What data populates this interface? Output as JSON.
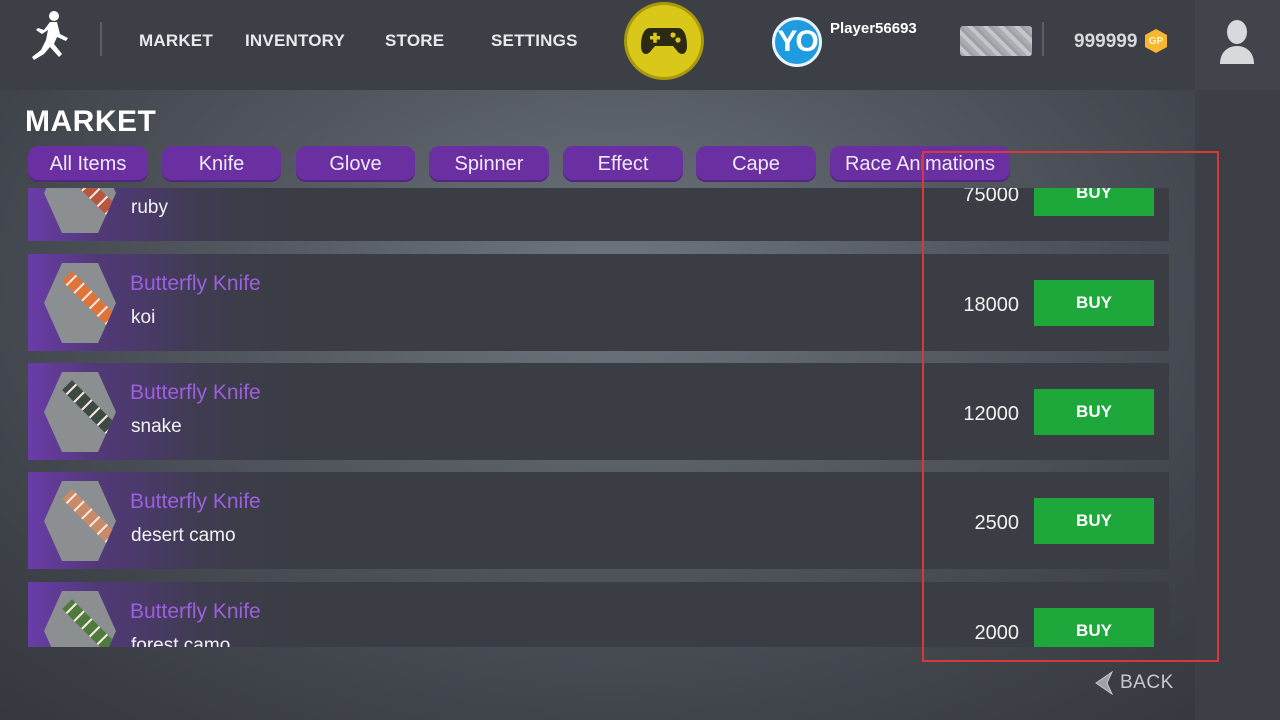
{
  "nav": {
    "items": [
      {
        "label": "MARKET"
      },
      {
        "label": "INVENTORY"
      },
      {
        "label": "STORE"
      },
      {
        "label": "SETTINGS"
      }
    ]
  },
  "player": {
    "logo_text": "YO",
    "name": "Player56693",
    "coins": "999999",
    "coin_symbol": "GP"
  },
  "market": {
    "title": "MARKET",
    "tabs": [
      {
        "label": "All Items"
      },
      {
        "label": "Knife"
      },
      {
        "label": "Glove"
      },
      {
        "label": "Spinner"
      },
      {
        "label": "Effect"
      },
      {
        "label": "Cape"
      },
      {
        "label": "Race Animations"
      }
    ],
    "buy_label": "BUY",
    "items": [
      {
        "name": "",
        "skin": "ruby",
        "price": "75000",
        "blade_color": "#b8573f"
      },
      {
        "name": "Butterfly Knife",
        "skin": "koi",
        "price": "18000",
        "blade_color": "#e0733a"
      },
      {
        "name": "Butterfly Knife",
        "skin": "snake",
        "price": "12000",
        "blade_color": "#3c4a42"
      },
      {
        "name": "Butterfly Knife",
        "skin": "desert camo",
        "price": "2500",
        "blade_color": "#c98a6a"
      },
      {
        "name": "Butterfly Knife",
        "skin": "forest camo",
        "price": "2000",
        "blade_color": "#4f7a3e"
      }
    ]
  },
  "back": {
    "label": "BACK"
  },
  "colors": {
    "accent_purple": "#6a2fa0",
    "item_name": "#9b5fe0",
    "buy_green": "#1ea83c",
    "highlight_red": "#d8383a",
    "gamepad_yellow": "#d9c819"
  }
}
